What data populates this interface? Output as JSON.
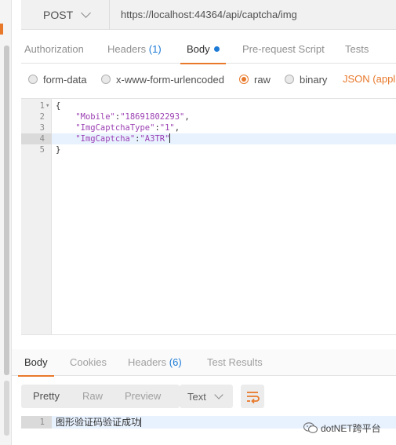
{
  "request": {
    "method": "POST",
    "url": "https://localhost:44364/api/captcha/img",
    "tabs": [
      {
        "label": "Authorization"
      },
      {
        "label": "Headers",
        "count": "(1)"
      },
      {
        "label": "Body"
      },
      {
        "label": "Pre-request Script"
      },
      {
        "label": "Tests"
      }
    ],
    "active_tab": "Body",
    "body_types": [
      "form-data",
      "x-www-form-urlencoded",
      "raw",
      "binary"
    ],
    "selected_body_type": "raw",
    "content_type": "JSON (applic"
  },
  "editor": {
    "lines": [
      {
        "num": "1",
        "text": "{"
      },
      {
        "num": "2",
        "key": "\"Mobile\"",
        "sep": ":",
        "value": "\"18691802293\"",
        "end": ","
      },
      {
        "num": "3",
        "key": "\"ImgCaptchaType\"",
        "sep": ":",
        "value": "\"1\"",
        "end": ","
      },
      {
        "num": "4",
        "key": "\"ImgCaptcha\"",
        "sep": ":",
        "value": "\"A3TR\"",
        "end": ""
      },
      {
        "num": "5",
        "text": "}"
      }
    ],
    "active_line": "4"
  },
  "response": {
    "tabs": [
      {
        "label": "Body"
      },
      {
        "label": "Cookies"
      },
      {
        "label": "Headers",
        "count": "(6)"
      },
      {
        "label": "Test Results"
      }
    ],
    "active_tab": "Body",
    "view_modes": [
      "Pretty",
      "Raw",
      "Preview"
    ],
    "active_view": "Pretty",
    "format": "Text",
    "line_num": "1",
    "body_text": "图形验证码验证成功"
  },
  "watermark": "dotNET跨平台",
  "colors": {
    "accent": "#e8792b",
    "link": "#1d7bd6",
    "string": "#9b3fb3"
  },
  "icons": [
    "chevron-down-icon",
    "wrap-lines-icon",
    "fold-arrow-icon",
    "wechat-icon"
  ]
}
